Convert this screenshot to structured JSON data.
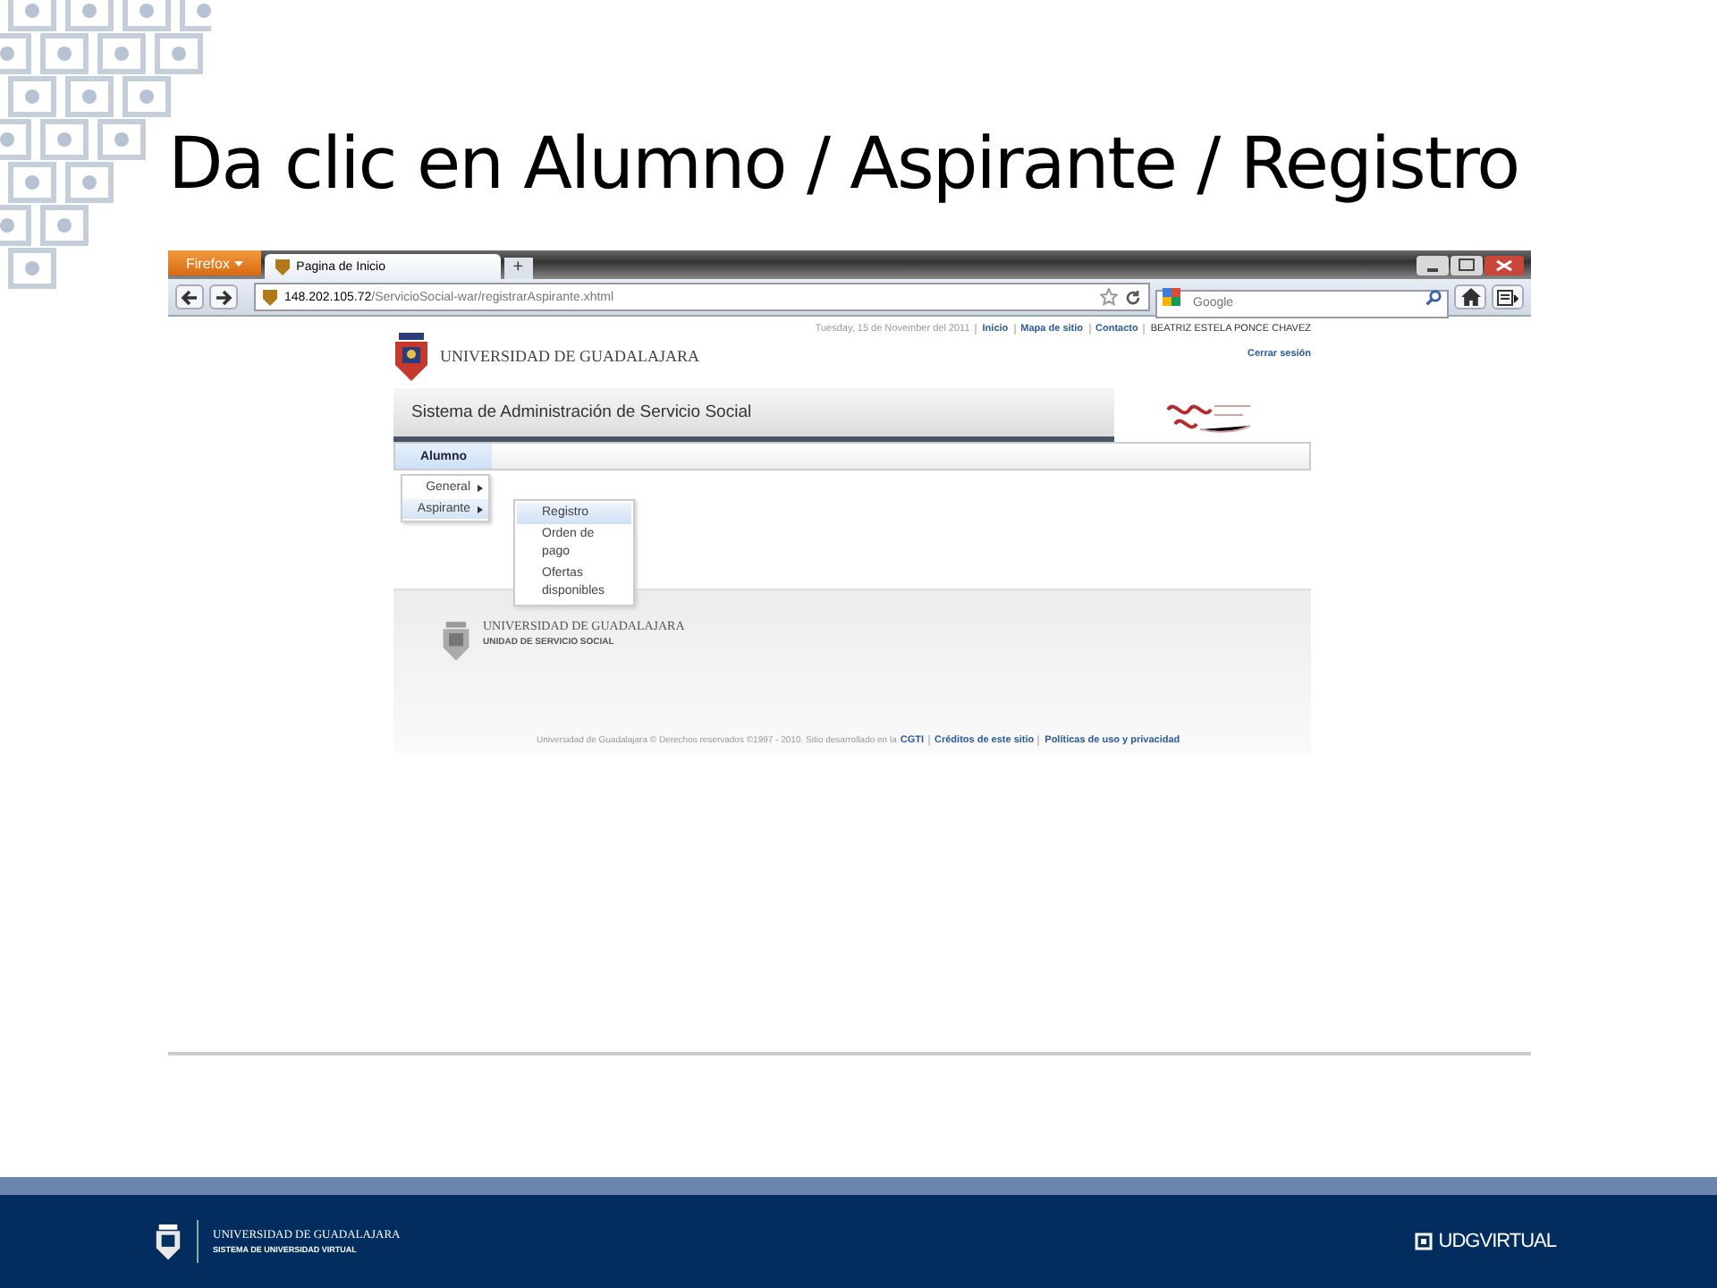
{
  "slide": {
    "title": "Da clic en Alumno / Aspirante / Registro"
  },
  "browser": {
    "app_button": "Firefox",
    "tab": {
      "title": "Pagina de Inicio"
    },
    "new_tab": "+",
    "address": {
      "host": "148.202.105.72",
      "path": "/ServicioSocial-war/registrarAspirante.xhtml"
    },
    "search": {
      "placeholder": "Google"
    }
  },
  "page": {
    "logo_text": "UNIVERSIDAD DE GUADALAJARA",
    "date": "Tuesday, 15 de November del 2011",
    "top_links": [
      "Inicio",
      "Mapa de sitio",
      "Contacto"
    ],
    "user": "BEATRIZ ESTELA PONCE CHAVEZ",
    "logout": "Cerrar sesión",
    "system_title": "Sistema de Administración de Servicio Social",
    "menu": [
      {
        "label": "Alumno",
        "selected": true
      }
    ],
    "submenu": [
      {
        "label": "General",
        "selected": false
      },
      {
        "label": "Aspirante",
        "selected": true
      }
    ],
    "flyout": [
      {
        "label": "Registro",
        "selected": true
      },
      {
        "label": "Orden de pago",
        "selected": false
      },
      {
        "label": "Ofertas disponibles",
        "selected": false
      }
    ],
    "footer": {
      "university": "UNIVERSIDAD DE GUADALAJARA",
      "unit": "UNIDAD DE SERVICIO SOCIAL",
      "copyright": "Universidad de Guadalajara © Derechos reservados ©1997 - 2010. Sitio desarrollado en la",
      "links": [
        "CGTI",
        "Créditos de este sitio",
        "Políticas de uso y privacidad"
      ]
    }
  },
  "slide_footer": {
    "university": "UNIVERSIDAD DE GUADALAJARA",
    "system": "SISTEMA DE UNIVERSIDAD VIRTUAL",
    "brand": "UDGVIRTUAL"
  }
}
